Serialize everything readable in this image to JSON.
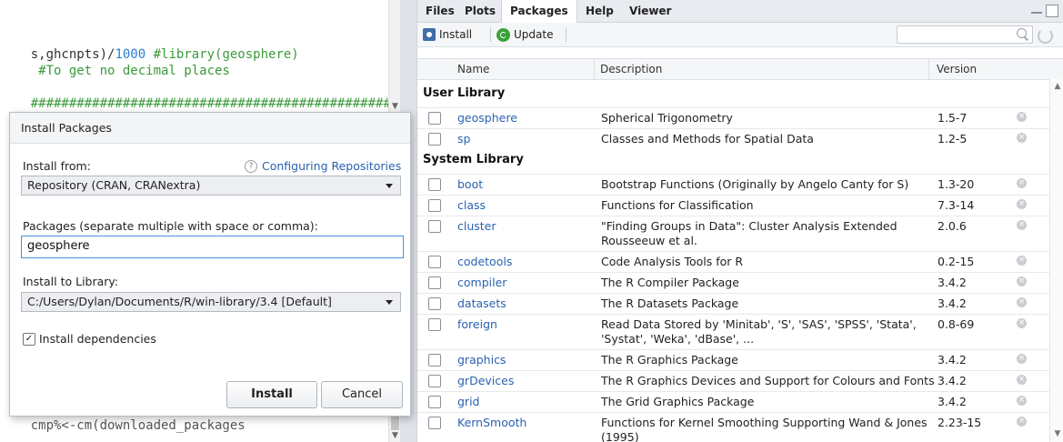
{
  "editor": {
    "line1_part1": "s,ghcnpts)/",
    "line1_num": "1000",
    "line1_comment": " #library(geosphere)",
    "line2_comment": " #To get no decimal places",
    "line3_hashes": "###############################################",
    "line4_partial": "cmp%<-cm(downloaded_packages"
  },
  "tabs": [
    "Files",
    "Plots",
    "Packages",
    "Help",
    "Viewer"
  ],
  "active_tab": "Packages",
  "toolbar": {
    "install_label": "Install",
    "update_label": "Update"
  },
  "table": {
    "columns": [
      "Name",
      "Description",
      "Version"
    ],
    "groups": [
      {
        "label": "User Library",
        "rows": [
          {
            "name": "geosphere",
            "desc": "Spherical Trigonometry",
            "ver": "1.5-7"
          },
          {
            "name": "sp",
            "desc": "Classes and Methods for Spatial Data",
            "ver": "1.2-5"
          }
        ]
      },
      {
        "label": "System Library",
        "rows": [
          {
            "name": "boot",
            "desc": "Bootstrap Functions (Originally by Angelo Canty for S)",
            "ver": "1.3-20"
          },
          {
            "name": "class",
            "desc": "Functions for Classification",
            "ver": "7.3-14"
          },
          {
            "name": "cluster",
            "desc": "\"Finding Groups in Data\": Cluster Analysis Extended Rousseeuw et al.",
            "ver": "2.0.6"
          },
          {
            "name": "codetools",
            "desc": "Code Analysis Tools for R",
            "ver": "0.2-15"
          },
          {
            "name": "compiler",
            "desc": "The R Compiler Package",
            "ver": "3.4.2"
          },
          {
            "name": "datasets",
            "desc": "The R Datasets Package",
            "ver": "3.4.2"
          },
          {
            "name": "foreign",
            "desc": "Read Data Stored by 'Minitab', 'S', 'SAS', 'SPSS', 'Stata', 'Systat', 'Weka', 'dBase', ...",
            "ver": "0.8-69"
          },
          {
            "name": "graphics",
            "desc": "The R Graphics Package",
            "ver": "3.4.2"
          },
          {
            "name": "grDevices",
            "desc": "The R Graphics Devices and Support for Colours and Fonts",
            "ver": "3.4.2"
          },
          {
            "name": "grid",
            "desc": "The Grid Graphics Package",
            "ver": "3.4.2"
          },
          {
            "name": "KernSmooth",
            "desc": "Functions for Kernel Smoothing Supporting Wand & Jones (1995)",
            "ver": "2.23-15"
          }
        ]
      }
    ]
  },
  "dialog": {
    "title": "Install Packages",
    "install_from_label": "Install from:",
    "config_link": "Configuring Repositories",
    "install_from_value": "Repository (CRAN, CRANextra)",
    "packages_label": "Packages (separate multiple with space or comma):",
    "packages_value": "geosphere",
    "library_label": "Install to Library:",
    "library_value": "C:/Users/Dylan/Documents/R/win-library/3.4 [Default]",
    "deps_label": "Install dependencies",
    "deps_checked": true,
    "install_button": "Install",
    "cancel_button": "Cancel"
  }
}
